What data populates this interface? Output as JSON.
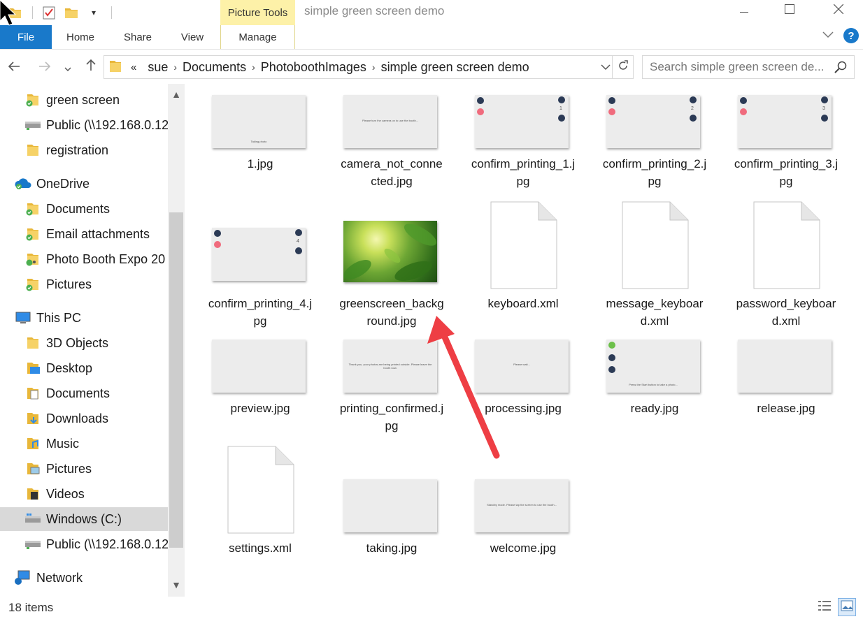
{
  "window": {
    "title": "simple green screen demo",
    "context_tab": "Picture Tools",
    "minimize_icon": "minimize-icon",
    "maximize_icon": "maximize-icon",
    "close_icon": "close-icon"
  },
  "ribbon": {
    "tabs": [
      "File",
      "Home",
      "Share",
      "View",
      "Manage"
    ],
    "help_label": "?"
  },
  "address": {
    "overflow": "«",
    "crumbs": [
      "sue",
      "Documents",
      "PhotoboothImages",
      "simple green screen demo"
    ]
  },
  "search": {
    "placeholder": "Search simple green screen de..."
  },
  "nav": {
    "items": [
      {
        "label": "green screen",
        "icon": "folder-synced-icon"
      },
      {
        "label": "Public (\\\\192.168.0.12",
        "icon": "network-drive-icon"
      },
      {
        "label": "registration",
        "icon": "folder-icon"
      },
      {
        "label": "OneDrive",
        "icon": "onedrive-icon"
      },
      {
        "label": "Documents",
        "icon": "folder-synced-icon"
      },
      {
        "label": "Email attachments",
        "icon": "folder-synced-icon"
      },
      {
        "label": "Photo Booth Expo 20",
        "icon": "folder-shared-icon"
      },
      {
        "label": "Pictures",
        "icon": "folder-synced-icon"
      },
      {
        "label": "This PC",
        "icon": "computer-icon"
      },
      {
        "label": "3D Objects",
        "icon": "3d-objects-icon"
      },
      {
        "label": "Desktop",
        "icon": "desktop-folder-icon"
      },
      {
        "label": "Documents",
        "icon": "documents-folder-icon"
      },
      {
        "label": "Downloads",
        "icon": "downloads-folder-icon"
      },
      {
        "label": "Music",
        "icon": "music-folder-icon"
      },
      {
        "label": "Pictures",
        "icon": "pictures-folder-icon"
      },
      {
        "label": "Videos",
        "icon": "videos-folder-icon"
      },
      {
        "label": "Windows (C:)",
        "icon": "windows-drive-icon"
      },
      {
        "label": "Public (\\\\192.168.0.12",
        "icon": "network-drive-icon"
      },
      {
        "label": "Network",
        "icon": "network-icon"
      }
    ]
  },
  "files": [
    {
      "name": "1.jpg",
      "kind": "image",
      "caption": "Taking photo"
    },
    {
      "name": "camera_not_connected.jpg",
      "kind": "image",
      "caption": "Please turn the camera on to use the booth..."
    },
    {
      "name": "confirm_printing_1.jpg",
      "kind": "image-buttons",
      "count": "1"
    },
    {
      "name": "confirm_printing_2.jpg",
      "kind": "image-buttons",
      "count": "2"
    },
    {
      "name": "confirm_printing_3.jpg",
      "kind": "image-buttons",
      "count": "3"
    },
    {
      "name": "confirm_printing_4.jpg",
      "kind": "image-buttons",
      "count": "4"
    },
    {
      "name": "greenscreen_background.jpg",
      "kind": "image-green"
    },
    {
      "name": "keyboard.xml",
      "kind": "document"
    },
    {
      "name": "message_keyboard.xml",
      "kind": "document"
    },
    {
      "name": "password_keyboard.xml",
      "kind": "document"
    },
    {
      "name": "preview.jpg",
      "kind": "image"
    },
    {
      "name": "printing_confirmed.jpg",
      "kind": "image",
      "caption": "Thank you, your photos are being printed outside. Please leave the booth now."
    },
    {
      "name": "processing.jpg",
      "kind": "image",
      "caption": "Please wait..."
    },
    {
      "name": "ready.jpg",
      "kind": "image-ready",
      "caption": "Press the Start button to take a photo..."
    },
    {
      "name": "release.jpg",
      "kind": "image"
    },
    {
      "name": "settings.xml",
      "kind": "document"
    },
    {
      "name": "taking.jpg",
      "kind": "image"
    },
    {
      "name": "welcome.jpg",
      "kind": "image",
      "caption": "Standby mode. Please tap the screen to use the booth..."
    }
  ],
  "status": {
    "item_count": "18 items"
  },
  "colors": {
    "accent": "#1979ca",
    "context_tab": "#fdf1a8",
    "annotation_arrow": "#ee3e44"
  }
}
